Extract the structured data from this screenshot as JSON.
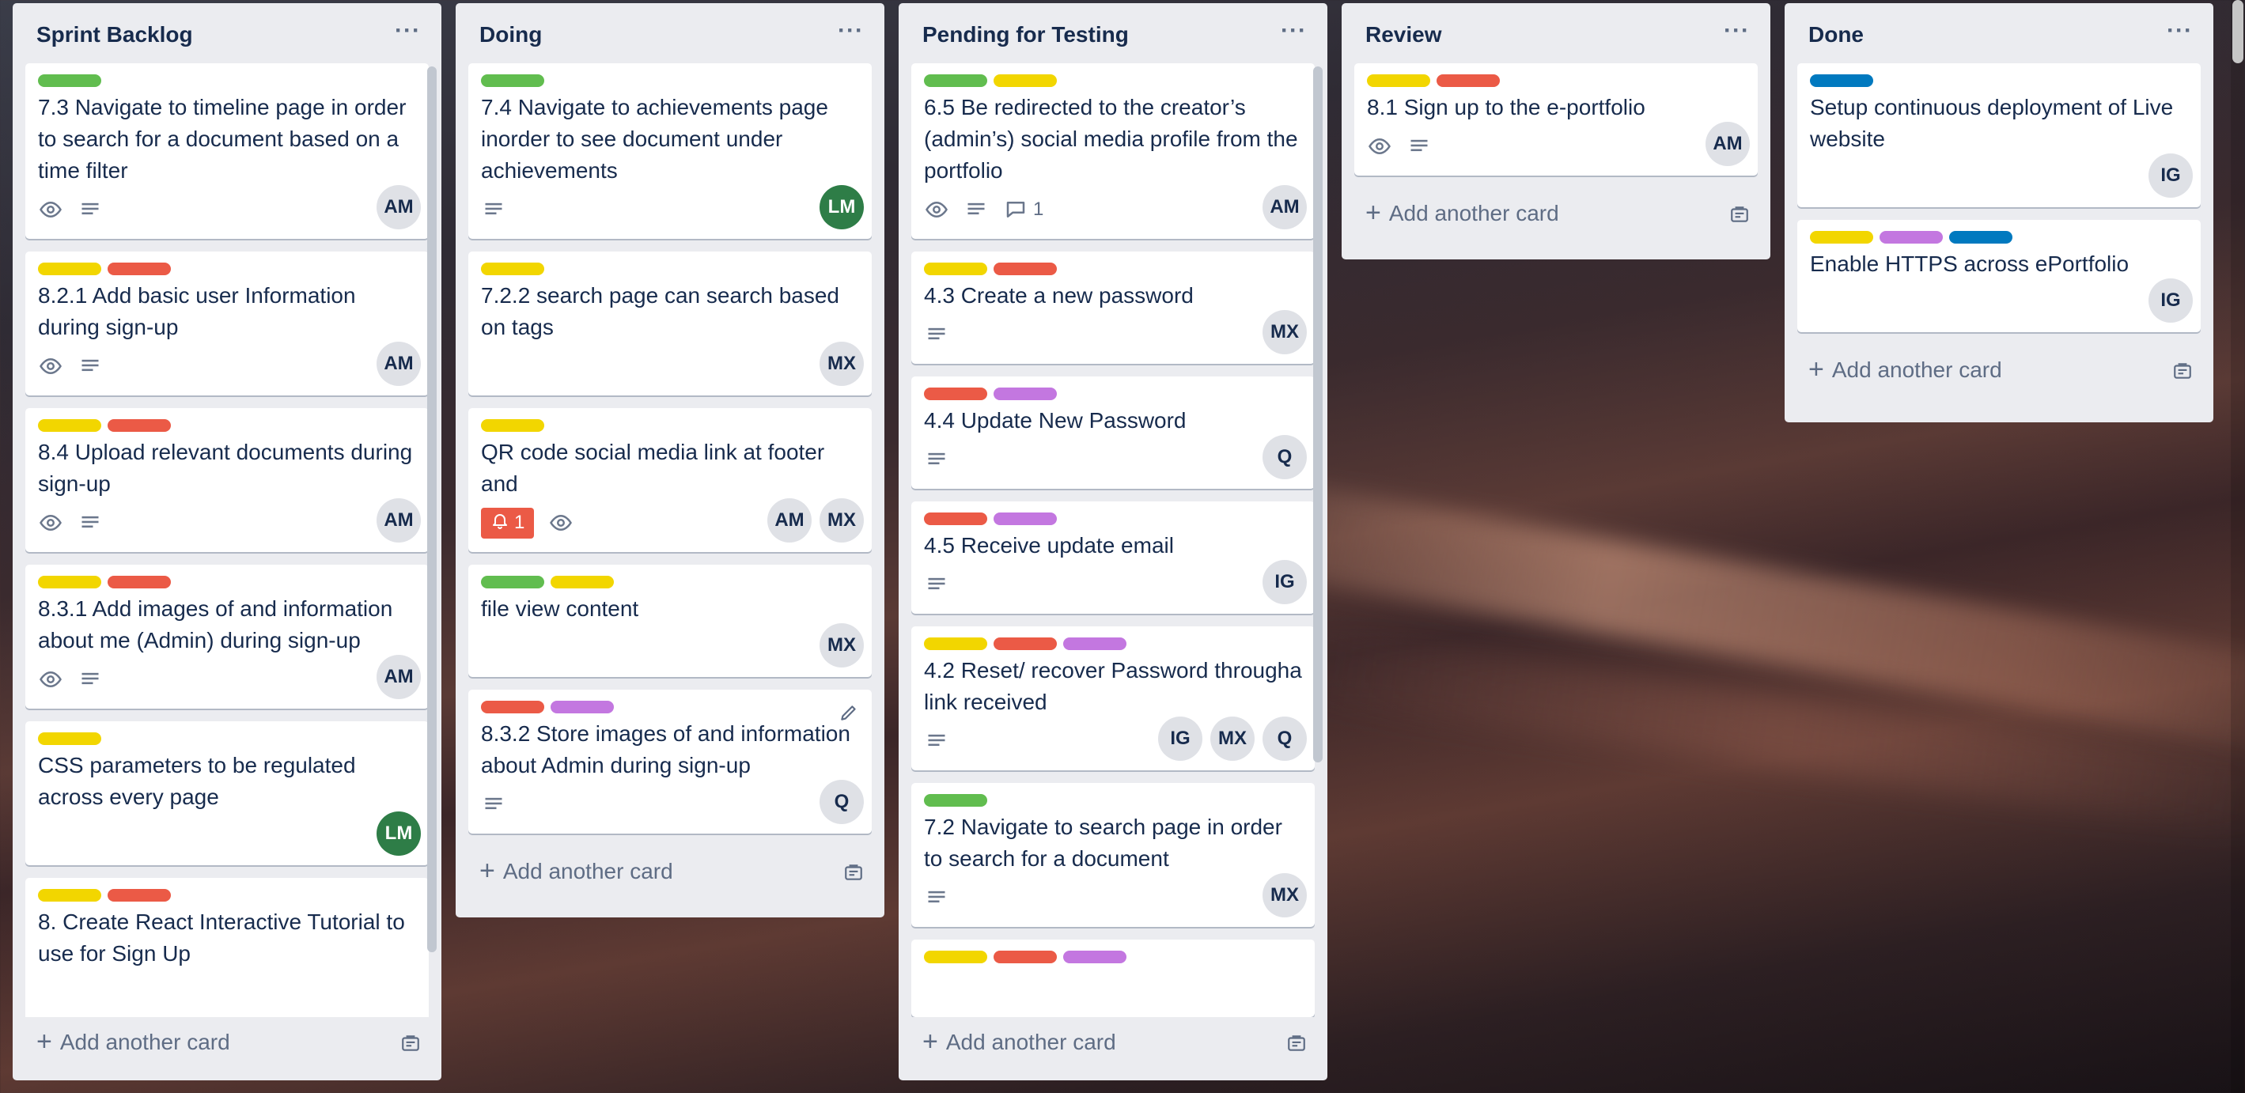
{
  "lists": [
    {
      "title": "Sprint Backlog",
      "cards": [
        {
          "labels": [
            "green"
          ],
          "title": "7.3 Navigate to timeline page in order to search for a document based on a time filter",
          "icons": [
            "eye",
            "description"
          ],
          "avatars": [
            "AM"
          ]
        },
        {
          "labels": [
            "yellow",
            "red"
          ],
          "title": "8.2.1 Add basic user Information during sign-up",
          "icons": [
            "eye",
            "description"
          ],
          "avatars": [
            "AM"
          ]
        },
        {
          "labels": [
            "yellow",
            "red"
          ],
          "title": "8.4 Upload relevant documents during sign-up",
          "icons": [
            "eye",
            "description"
          ],
          "avatars": [
            "AM"
          ]
        },
        {
          "labels": [
            "yellow",
            "red"
          ],
          "title": "8.3.1 Add images of and information about me (Admin) during sign-up",
          "icons": [
            "eye",
            "description"
          ],
          "avatars": [
            "AM"
          ]
        },
        {
          "labels": [
            "yellow"
          ],
          "title": "CSS parameters to be regulated across every page",
          "icons": [],
          "avatars": [
            "LM"
          ]
        },
        {
          "labels": [
            "yellow",
            "red"
          ],
          "title": "8. Create React Interactive Tutorial to use for Sign Up",
          "icons": [],
          "avatars": []
        }
      ],
      "add_label": "Add another card"
    },
    {
      "title": "Doing",
      "cards": [
        {
          "labels": [
            "green"
          ],
          "title": "7.4 Navigate to achievements page inorder to see document under achievements",
          "icons": [
            "description"
          ],
          "avatars": [
            "LM"
          ]
        },
        {
          "labels": [
            "yellow"
          ],
          "title": "7.2.2 search page can search based on tags",
          "icons": [],
          "avatars": [
            "MX"
          ]
        },
        {
          "labels": [
            "yellow"
          ],
          "title": "QR code social media link at footer and",
          "icons": [
            "notify",
            "eye"
          ],
          "notify": "1",
          "avatars": [
            "AM",
            "MX"
          ]
        },
        {
          "labels": [
            "green",
            "yellow"
          ],
          "title": "file view content",
          "icons": [],
          "avatars": [
            "MX"
          ]
        },
        {
          "labels": [
            "red",
            "purple"
          ],
          "title": "8.3.2 Store images of and information about Admin during sign-up",
          "icons": [
            "description"
          ],
          "avatars": [
            "Q"
          ],
          "edit": true
        }
      ],
      "add_label": "Add another card"
    },
    {
      "title": "Pending for Testing",
      "cards": [
        {
          "labels": [
            "green",
            "yellow"
          ],
          "title": "6.5 Be redirected to the creator’s (admin’s) social media profile from the portfolio",
          "icons": [
            "eye",
            "description",
            "comment"
          ],
          "comments": "1",
          "avatars": [
            "AM"
          ]
        },
        {
          "labels": [
            "yellow",
            "red"
          ],
          "title": "4.3 Create a new password",
          "icons": [
            "description"
          ],
          "avatars": [
            "MX"
          ]
        },
        {
          "labels": [
            "red",
            "purple"
          ],
          "title": "4.4 Update New Password",
          "icons": [
            "description"
          ],
          "avatars": [
            "Q"
          ]
        },
        {
          "labels": [
            "red",
            "purple"
          ],
          "title": "4.5 Receive update email",
          "icons": [
            "description"
          ],
          "avatars": [
            "IG"
          ]
        },
        {
          "labels": [
            "yellow",
            "red",
            "purple"
          ],
          "title": "4.2 Reset/ recover Password througha link received",
          "icons": [
            "description"
          ],
          "avatars": [
            "IG",
            "MX",
            "Q"
          ]
        },
        {
          "labels": [
            "green"
          ],
          "title": "7.2 Navigate to search page in order to search for a document",
          "icons": [
            "description"
          ],
          "avatars": [
            "MX"
          ]
        },
        {
          "labels": [
            "yellow",
            "red",
            "purple"
          ],
          "title": "",
          "icons": [],
          "avatars": []
        }
      ],
      "add_label": "Add another card"
    },
    {
      "title": "Review",
      "cards": [
        {
          "labels": [
            "yellow",
            "red"
          ],
          "title": "8.1 Sign up to the e-portfolio",
          "icons": [
            "eye",
            "description"
          ],
          "avatars": [
            "AM"
          ]
        }
      ],
      "add_label": "Add another card"
    },
    {
      "title": "Done",
      "cards": [
        {
          "labels": [
            "blue"
          ],
          "title": "Setup continuous deployment of Live website",
          "icons": [],
          "avatars": [
            "IG"
          ]
        },
        {
          "labels": [
            "yellow",
            "purple",
            "blue"
          ],
          "title": "Enable HTTPS across ePortfolio",
          "icons": [],
          "avatars": [
            "IG"
          ]
        }
      ],
      "add_label": "Add another card"
    }
  ],
  "colors": {
    "green": "#61bd4f",
    "yellow": "#f2d600",
    "red": "#eb5a46",
    "purple": "#c377e0",
    "blue": "#0079bf",
    "list_bg": "#ebecf0"
  }
}
